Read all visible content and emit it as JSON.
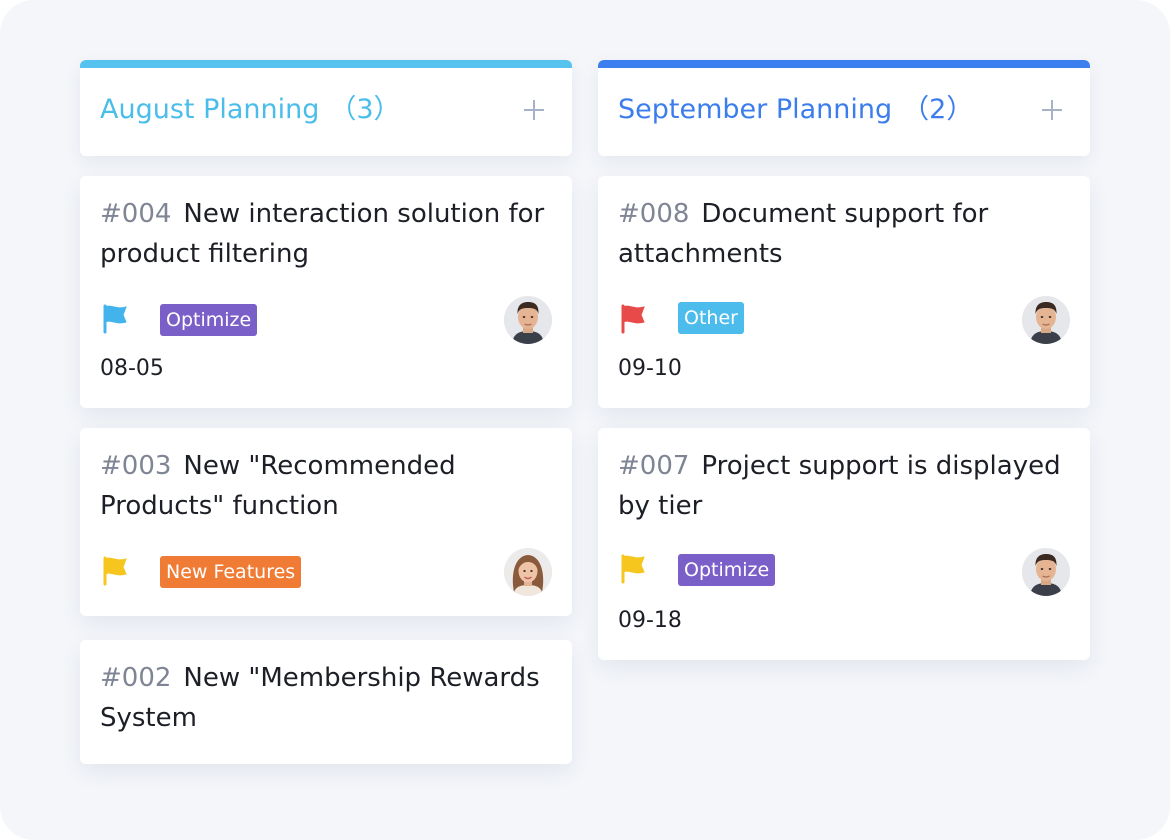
{
  "columns": {
    "august": {
      "title": "August Planning",
      "count": "（3）",
      "accent_color": "#56c3ee",
      "cards": [
        {
          "id": "#004",
          "title": "New interaction solution for product filtering",
          "flag_color": "#43b3ec",
          "tag": "Optimize",
          "tag_color": "#7b5fc8",
          "date": "08-05",
          "avatar": "male-avatar"
        },
        {
          "id": "#003",
          "title": "New \"Recommended Products\" function",
          "flag_color": "#f6c61f",
          "tag": "New Features",
          "tag_color": "#f07b34",
          "avatar": "female-avatar"
        },
        {
          "id": "#002",
          "title": "New \"Membership Rewards System"
        }
      ]
    },
    "september": {
      "title": "September Planning",
      "count": "（2）",
      "accent_color": "#3d7fef",
      "cards": [
        {
          "id": "#008",
          "title": "Document support for attachments",
          "flag_color": "#e84a4a",
          "tag": "Other",
          "tag_color": "#4bbcec",
          "date": "09-10",
          "avatar": "male-avatar"
        },
        {
          "id": "#007",
          "title": "Project support is displayed by tier",
          "flag_color": "#f6c61f",
          "tag": "Optimize",
          "tag_color": "#7b5fc8",
          "date": "09-18",
          "avatar": "male-avatar"
        }
      ]
    }
  },
  "icons": {
    "add": "plus-icon",
    "flag": "flag-icon"
  }
}
